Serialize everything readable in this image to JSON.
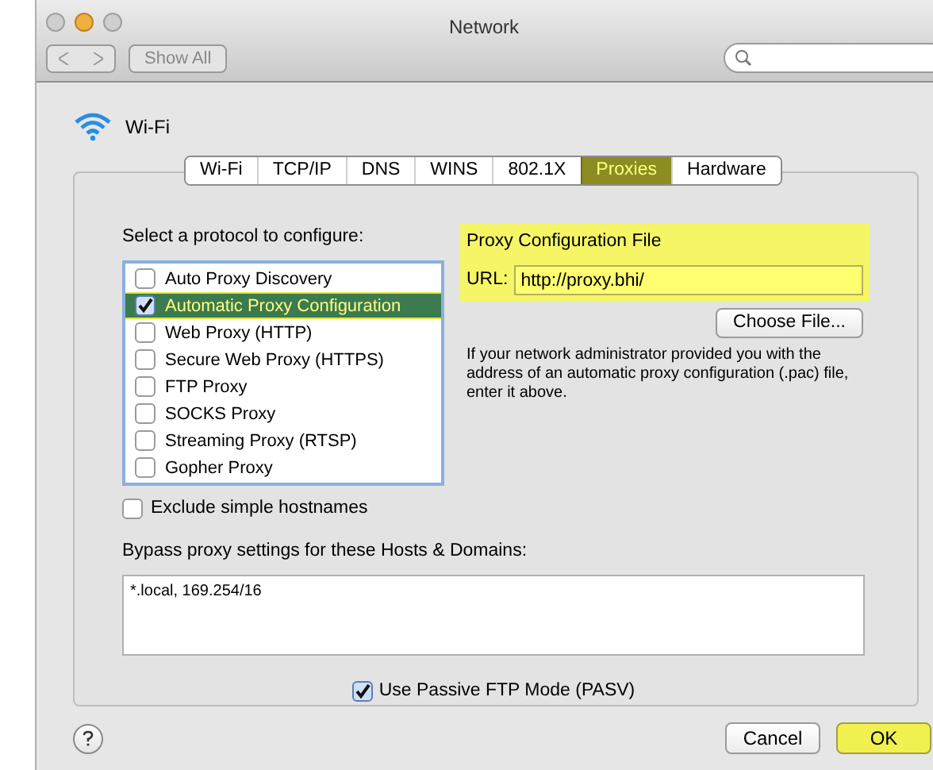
{
  "window": {
    "title": "Network"
  },
  "toolbar": {
    "show_all": "Show All"
  },
  "interface": {
    "name": "Wi-Fi"
  },
  "tabs": [
    {
      "label": "Wi-Fi",
      "selected": false
    },
    {
      "label": "TCP/IP",
      "selected": false
    },
    {
      "label": "DNS",
      "selected": false
    },
    {
      "label": "WINS",
      "selected": false
    },
    {
      "label": "802.1X",
      "selected": false
    },
    {
      "label": "Proxies",
      "selected": true
    },
    {
      "label": "Hardware",
      "selected": false
    }
  ],
  "protocol_label": "Select a protocol to configure:",
  "protocols": [
    {
      "label": "Auto Proxy Discovery",
      "checked": false,
      "selected": false
    },
    {
      "label": "Automatic Proxy Configuration",
      "checked": true,
      "selected": true
    },
    {
      "label": "Web Proxy (HTTP)",
      "checked": false,
      "selected": false
    },
    {
      "label": "Secure Web Proxy (HTTPS)",
      "checked": false,
      "selected": false
    },
    {
      "label": "FTP Proxy",
      "checked": false,
      "selected": false
    },
    {
      "label": "SOCKS Proxy",
      "checked": false,
      "selected": false
    },
    {
      "label": "Streaming Proxy (RTSP)",
      "checked": false,
      "selected": false
    },
    {
      "label": "Gopher Proxy",
      "checked": false,
      "selected": false
    }
  ],
  "config": {
    "title": "Proxy Configuration File",
    "url_label": "URL:",
    "url": "http://proxy.bhi/",
    "choose_button": "Choose File...",
    "description": "If your network administrator provided you with the address of an automatic proxy configuration (.pac) file, enter it above."
  },
  "exclude_simple": {
    "label": "Exclude simple hostnames",
    "checked": false
  },
  "bypass": {
    "label": "Bypass proxy settings for these Hosts & Domains:",
    "value": "*.local, 169.254/16"
  },
  "passive_ftp": {
    "label": "Use Passive FTP Mode (PASV)",
    "checked": true
  },
  "buttons": [
    {
      "label": "Cancel",
      "default": false
    },
    {
      "label": "OK",
      "default": true
    }
  ]
}
